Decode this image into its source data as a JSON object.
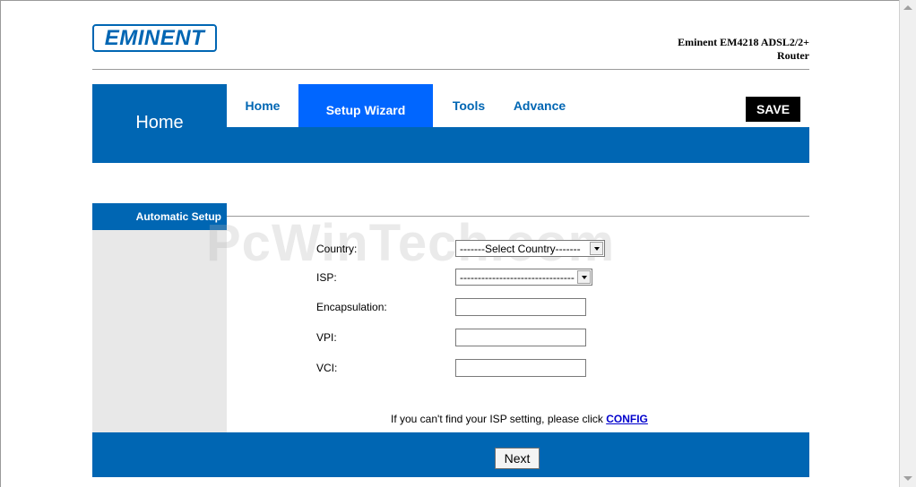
{
  "header": {
    "logo_text": "EMINENT",
    "product_line1": "Eminent EM4218 ADSL2/2+",
    "product_line2": "Router"
  },
  "nav": {
    "section_title": "Home",
    "tabs": [
      {
        "label": "Home",
        "active": false
      },
      {
        "label": "Setup Wizard",
        "active": true
      },
      {
        "label": "Tools",
        "active": false
      },
      {
        "label": "Advance",
        "active": false
      }
    ],
    "save_label": "SAVE"
  },
  "sidebar": {
    "header": "Automatic Setup"
  },
  "form": {
    "country_label": "Country:",
    "country_value": "-------Select Country-------",
    "isp_label": "ISP:",
    "isp_value": "--------------------------------",
    "encapsulation_label": "Encapsulation:",
    "encapsulation_value": "",
    "vpi_label": "VPI:",
    "vpi_value": "",
    "vci_label": "VCI:",
    "vci_value": ""
  },
  "config_prompt": {
    "text": "If you can't find your ISP setting, please click ",
    "link": "CONFIG"
  },
  "footer": {
    "next_label": "Next"
  },
  "watermark": "PcWinTech.com",
  "colors": {
    "brand_blue": "#0066b3",
    "active_tab": "#0066ff",
    "save_bg": "#000000",
    "sidebar_bg": "#e8e8e8",
    "link": "#0000cc"
  }
}
